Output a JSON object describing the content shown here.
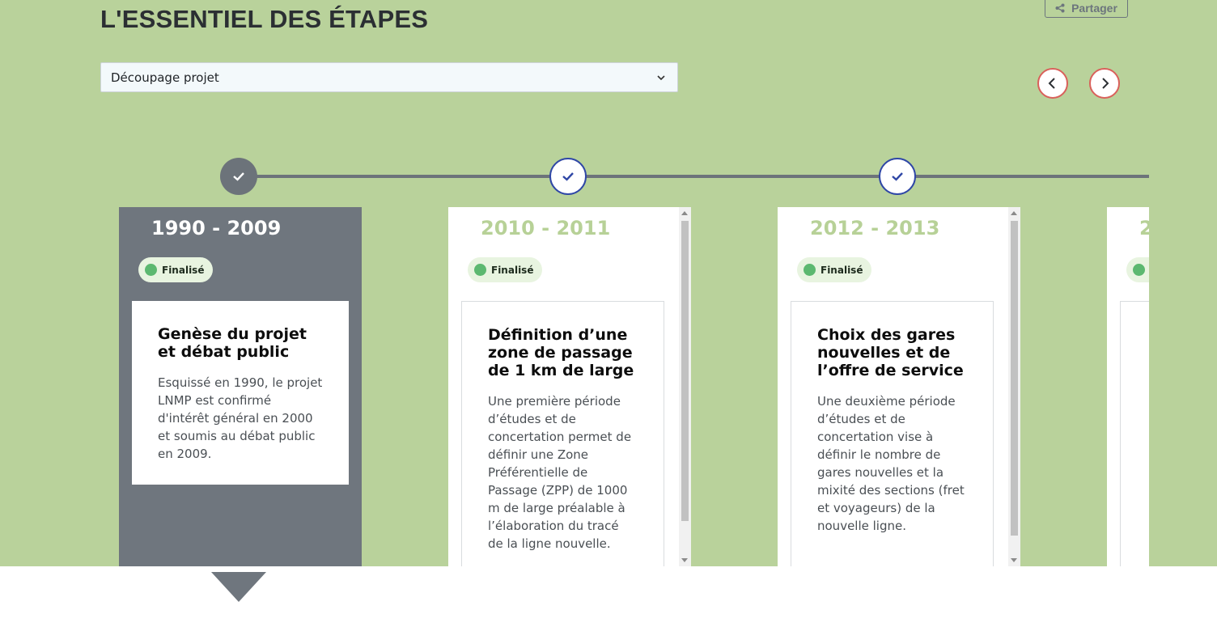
{
  "header": {
    "title": "L'ESSENTIEL DES ÉTAPES",
    "share_label": "Partager"
  },
  "filter": {
    "selected": "Découpage projet"
  },
  "colors": {
    "background": "#b9d29b",
    "active": "#6f767e",
    "accent_blue": "#2f47a6",
    "nav_border": "#d9605a",
    "status_green": "#5cb870"
  },
  "icons": {
    "share": "share-icon",
    "chevron": "chevron-down-icon",
    "prev": "chevron-left-icon",
    "next": "chevron-right-icon",
    "check": "check-icon"
  },
  "steps": [
    {
      "years": "1990 - 2009",
      "status": "Finalisé",
      "title": "Genèse du projet et débat public",
      "text": "Esquissé en 1990, le projet LNMP est confirmé d'intérêt général en 2000 et soumis au débat public en 2009."
    },
    {
      "years": "2010 - 2011",
      "status": "Finalisé",
      "title": "Définition d’une zone de passage de 1 km de large",
      "text": "Une première période d’études et de concertation permet de définir une Zone Préférentielle de Passage (ZPP) de 1000 m de large préalable à l’élaboration du tracé de la ligne nouvelle."
    },
    {
      "years": "2012 - 2013",
      "status": "Finalisé",
      "title": "Choix des gares nouvelles et de l’offre de service",
      "text": "Une deuxième période d’études et de concertation vise à définir le nombre de gares nouvelles et la mixité des sections (fret et voyageurs) de la nouvelle ligne."
    },
    {
      "years": "2",
      "status": "",
      "title": "",
      "text": ""
    }
  ]
}
